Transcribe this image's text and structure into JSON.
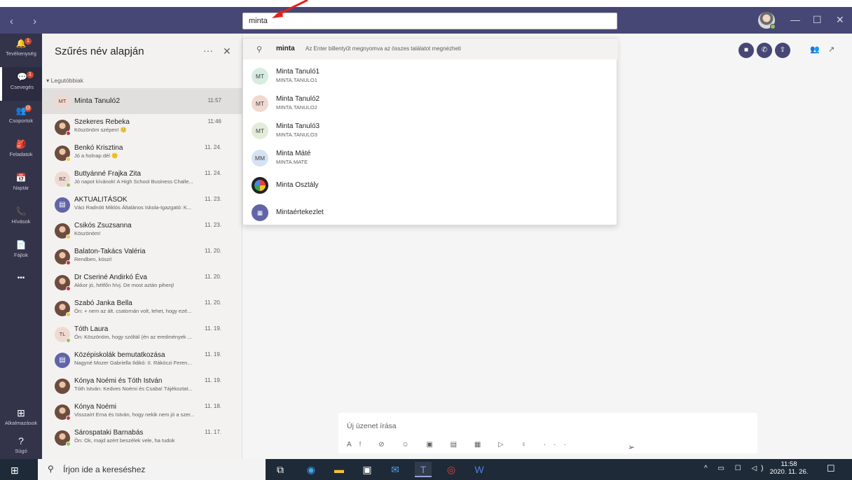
{
  "search": {
    "value": "minta"
  },
  "rail": [
    {
      "label": "Tevékenység",
      "icon": "bell-icon",
      "glyph": "🔔",
      "badge": "1"
    },
    {
      "label": "Csevegés",
      "icon": "chat-icon",
      "glyph": "💬",
      "badge": "1"
    },
    {
      "label": "Csoportok",
      "icon": "teams-icon",
      "glyph": "👥",
      "badge": "@"
    },
    {
      "label": "Feladatok",
      "icon": "assignments-icon",
      "glyph": "🎒",
      "badge": ""
    },
    {
      "label": "Naptár",
      "icon": "calendar-icon",
      "glyph": "📅",
      "badge": ""
    },
    {
      "label": "Hívások",
      "icon": "phone-icon",
      "glyph": "📞",
      "badge": ""
    },
    {
      "label": "Fájlok",
      "icon": "files-icon",
      "glyph": "📄",
      "badge": ""
    },
    {
      "label": "",
      "icon": "more-apps-icon",
      "glyph": "•••",
      "badge": ""
    }
  ],
  "rail_bottom": [
    {
      "label": "Alkalmazások",
      "icon": "apps-icon",
      "glyph": "⊞"
    },
    {
      "label": "Súgó",
      "icon": "help-icon",
      "glyph": "?"
    }
  ],
  "list": {
    "title": "Szűrés név alapján",
    "more": "···",
    "close": "✕",
    "section": "Legutóbbiak"
  },
  "chats": [
    {
      "name": "Minta Tanuló2",
      "preview": "",
      "time": "11:57",
      "initials": "MT",
      "status": "",
      "type": "initials"
    },
    {
      "name": "Szekeres Rebeka",
      "preview": "Köszönöm szépen! 🙂",
      "time": "11:46",
      "initials": "",
      "status": "red",
      "type": "photo"
    },
    {
      "name": "Benkó Krisztina",
      "preview": "Jó a holnap dél 🙂",
      "time": "11. 24.",
      "initials": "",
      "status": "yellow",
      "type": "photo"
    },
    {
      "name": "Buttyánné Frajka Zita",
      "preview": "Jó napot kívánok! A High School Business Challe...",
      "time": "11. 24.",
      "initials": "BZ",
      "status": "green",
      "type": "initials"
    },
    {
      "name": "AKTUALITÁSOK",
      "preview": "Váci Radnóti Miklós Általános Iskola-Igazgató: K...",
      "time": "11. 23.",
      "initials": "",
      "status": "",
      "type": "channel"
    },
    {
      "name": "Csikós Zsuzsanna",
      "preview": "Köszönöm!",
      "time": "11. 23.",
      "initials": "",
      "status": "yellow",
      "type": "photo"
    },
    {
      "name": "Balaton-Takács Valéria",
      "preview": "Rendben, köszi!",
      "time": "11. 20.",
      "initials": "",
      "status": "red",
      "type": "photo"
    },
    {
      "name": "Dr Cseriné Andirkó Éva",
      "preview": "Akkor jó, hétfőn hívj. De most aztán pihenj!",
      "time": "11. 20.",
      "initials": "",
      "status": "red",
      "type": "photo"
    },
    {
      "name": "Szabó Janka Bella",
      "preview": "Ön: + nem az ált. csatornán volt, lehet, hogy ezé...",
      "time": "11. 20.",
      "initials": "",
      "status": "yellow",
      "type": "photo"
    },
    {
      "name": "Tóth Laura",
      "preview": "Ön: Köszönöm, hogy szóltál (én az eredmények ...",
      "time": "11. 19.",
      "initials": "TL",
      "status": "green",
      "type": "initials"
    },
    {
      "name": "Középiskolák bemutatkozása",
      "preview": "Nagyné Mozer Gabriella Ildikó: II. Rákóczi Feren...",
      "time": "11. 19.",
      "initials": "",
      "status": "",
      "type": "channel"
    },
    {
      "name": "Kónya Noémi és Tóth István",
      "preview": "Tóth István: Kedves Noémi és Csaba! Tájékoztat...",
      "time": "11. 19.",
      "initials": "",
      "status": "",
      "type": "photo"
    },
    {
      "name": "Kónya Noémi",
      "preview": "Visszaírt Erna és István, hogy nekik nem jó a szer...",
      "time": "11. 18.",
      "initials": "",
      "status": "red",
      "type": "photo"
    },
    {
      "name": "Sárospataki Barnabás",
      "preview": "Ön: Ok, majd azért beszélek vele, ha tudok",
      "time": "11. 17.",
      "initials": "",
      "status": "green",
      "type": "photo"
    }
  ],
  "dropdown": {
    "query": "minta",
    "hint": "Az Enter billentyűt megnyomva az összes találatot megnézheti",
    "results": [
      {
        "name": "Minta Tanuló1",
        "sub": "MINTA.TANULO1",
        "initials": "MT",
        "color": "#d6ede2"
      },
      {
        "name": "Minta Tanuló2",
        "sub": "MINTA.TANULO2",
        "initials": "MT",
        "color": "#f0d9d0"
      },
      {
        "name": "Minta Tanuló3",
        "sub": "MINTA.TANULO3",
        "initials": "MT",
        "color": "#e3ecd9"
      },
      {
        "name": "Minta Máté",
        "sub": "MINTA.MATE",
        "initials": "MM",
        "color": "#d5e2f2"
      },
      {
        "name": "Minta Osztály",
        "sub": "",
        "initials": "",
        "color": "#222"
      },
      {
        "name": "Mintaértekezlet",
        "sub": "",
        "initials": "",
        "color": "#6264a7"
      }
    ]
  },
  "compose": {
    "placeholder": "Új üzenet írása"
  },
  "taskbar": {
    "search_placeholder": "Írjon ide a kereséshez",
    "time": "11:58",
    "date": "2020. 11. 26."
  },
  "colors": {
    "teams_purple": "#464775",
    "rail": "#33344a",
    "accent": "#6264a7"
  }
}
